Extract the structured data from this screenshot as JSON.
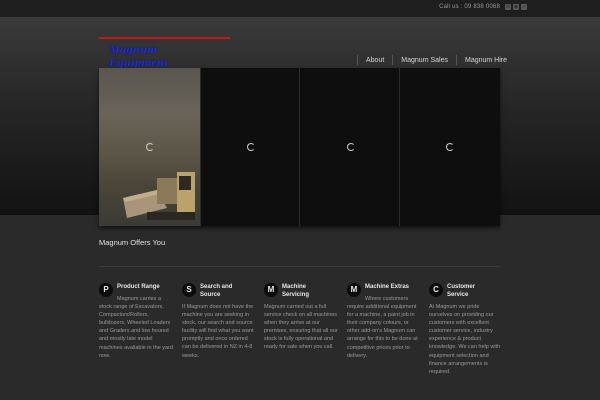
{
  "topbar": {
    "call_label": "Call us : 09 838 0068",
    "social_icons": [
      "email-icon",
      "rss-icon",
      "share-icon"
    ]
  },
  "logo": {
    "line1": "Magnum",
    "line2": "Equipment",
    "colors": {
      "text": "#1f2fd0",
      "bars": "#c41818"
    }
  },
  "nav": {
    "items": [
      {
        "label": "About"
      },
      {
        "label": "Magnum Sales"
      },
      {
        "label": "Magnum Hire"
      }
    ]
  },
  "slider": {
    "panels": 4
  },
  "section": {
    "title": "Magnum Offers You"
  },
  "features": [
    {
      "letter": "P",
      "title": "Product Range",
      "body": "Magnum carries a stock range of Excavators, Compactors/Rollers, bulldozers, Wheeled Loaders and Graders and low houred and mostly late model machines available in the yard now."
    },
    {
      "letter": "S",
      "title": "Search and Source",
      "body": "If Magnum does not have the machine you are seeking in stock, our search and source facility will find what you want promptly and once ordered can be delivered in NZ in 4-8 weeks."
    },
    {
      "letter": "M",
      "title": "Machine Servicing",
      "body": "Magnum carried out a full service check on all machines when they arrive at our premises, ensuring that all our stock is fully operational and ready for sale when you call."
    },
    {
      "letter": "M",
      "title": "Machine Extras",
      "body": "Where customers require additional equipment for a machine, a paint job in their company colours, or other add-on's Magnum can arrange for this to be done at competitive prices prior to delivery."
    },
    {
      "letter": "C",
      "title": "Customer Service",
      "body": "At Magnum we pride ourselves on providing our customers with excellent customer service, industry experience & product knowledge. We can help with equipment selection and finance arrangements is required."
    }
  ]
}
